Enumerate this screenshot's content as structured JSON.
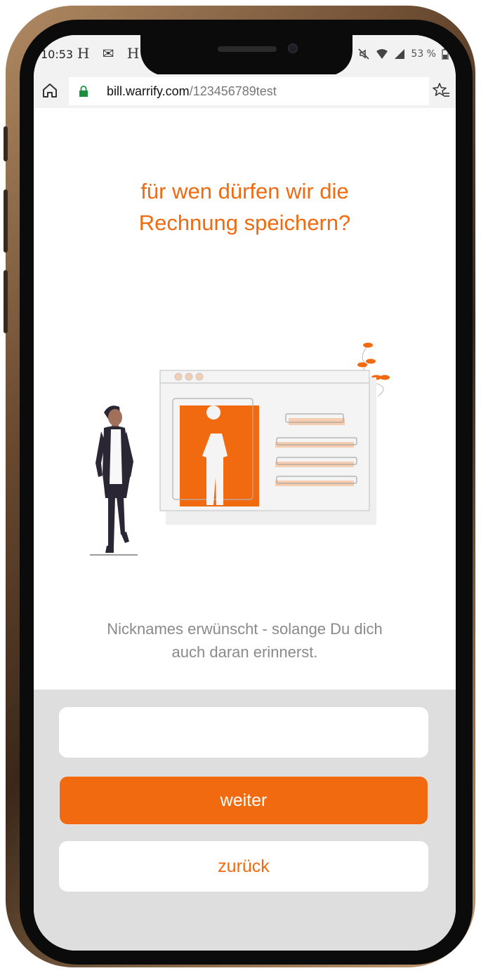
{
  "status_bar": {
    "time": "10:53",
    "left_icons": "H ✉ H",
    "battery": "53 %",
    "icons": [
      "mute-icon",
      "wifi-icon",
      "signal-icon",
      "battery-icon"
    ]
  },
  "browser": {
    "url_domain": "bill.warrify.com",
    "url_path": "/123456789test",
    "icons": [
      "home-icon",
      "lock-icon",
      "bookmark-star-icon"
    ]
  },
  "main": {
    "headline_line1": "für wen dürfen wir die",
    "headline_line2": "Rechnung speichern?",
    "subtext_line1": "Nicknames erwünscht - solange Du dich",
    "subtext_line2": "auch daran erinnerst."
  },
  "form": {
    "name_value": "",
    "name_placeholder": "",
    "next_label": "weiter",
    "back_label": "zurück"
  },
  "colors": {
    "accent": "#f26a10",
    "panel": "#dedede",
    "text_muted": "#8a8a8a"
  }
}
